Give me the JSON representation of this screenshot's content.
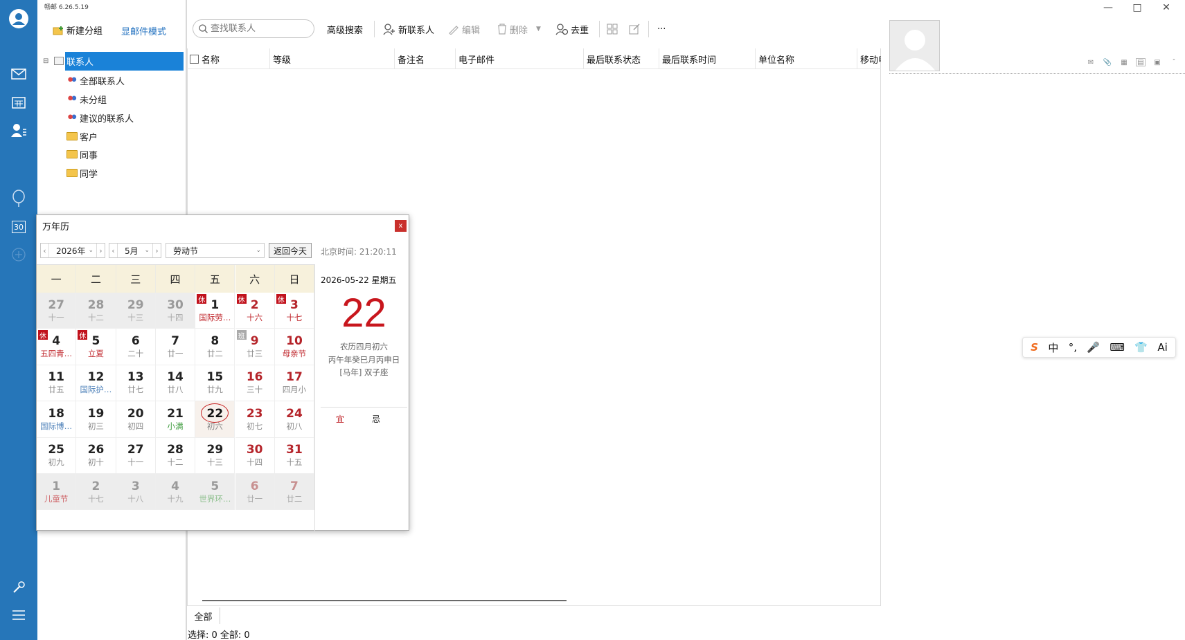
{
  "app": {
    "version": "畅邮 6.26.5.19"
  },
  "rail": {
    "icons": [
      "user-avatar-icon",
      "mail-icon",
      "calendar-icon",
      "contacts-icon",
      "balloon-icon",
      "calendar-30-icon",
      "add-icon",
      "tools-icon",
      "menu-icon"
    ],
    "accent": "#2676b9",
    "calendar_icon_text": "30"
  },
  "sidebar": {
    "new_group": "新建分组",
    "mail_mode": "显邮件模式",
    "root": "联系人",
    "items": [
      {
        "label": "全部联系人",
        "icon": "people-icon"
      },
      {
        "label": "未分组",
        "icon": "people-icon"
      },
      {
        "label": "建议的联系人",
        "icon": "people-icon"
      },
      {
        "label": "客户",
        "icon": "folder-icon"
      },
      {
        "label": "同事",
        "icon": "folder-icon"
      },
      {
        "label": "同学",
        "icon": "folder-icon"
      }
    ]
  },
  "toolbar": {
    "search_placeholder": "查找联系人",
    "advanced": "高级搜索",
    "new_contact": "新联系人",
    "edit": "编辑",
    "delete": "删除",
    "dedupe": "去重",
    "more": "···"
  },
  "table": {
    "columns": [
      "名称",
      "等级",
      "备注名",
      "电子邮件",
      "最后联系状态",
      "最后联系时间",
      "单位名称",
      "移动电话"
    ]
  },
  "bottom": {
    "tab": "全部",
    "status": "选择: 0  全部: 0"
  },
  "calendar": {
    "title": "万年历",
    "close": "x",
    "year": "2026年",
    "month": "5月",
    "holiday": "劳动节",
    "today_btn": "返回今天",
    "bj_time": "北京时间: 21:20:11",
    "weekdays": [
      "一",
      "二",
      "三",
      "四",
      "五",
      "六",
      "日"
    ],
    "cells": [
      {
        "n": "27",
        "l": "十一",
        "o": 1
      },
      {
        "n": "28",
        "l": "十二",
        "o": 1
      },
      {
        "n": "29",
        "l": "十三",
        "o": 1
      },
      {
        "n": "30",
        "l": "十四",
        "o": 1
      },
      {
        "n": "1",
        "l": "国际劳…",
        "b": "休",
        "c": "red"
      },
      {
        "n": "2",
        "l": "十六",
        "b": "休",
        "c": "red",
        "w": 1
      },
      {
        "n": "3",
        "l": "十七",
        "b": "休",
        "c": "red",
        "w": 1
      },
      {
        "n": "4",
        "l": "五四青…",
        "b": "休",
        "c": "red"
      },
      {
        "n": "5",
        "l": "立夏",
        "b": "休",
        "c": "red"
      },
      {
        "n": "6",
        "l": "二十"
      },
      {
        "n": "7",
        "l": "廿一"
      },
      {
        "n": "8",
        "l": "廿二"
      },
      {
        "n": "9",
        "l": "廿三",
        "b": "班",
        "w": 1
      },
      {
        "n": "10",
        "l": "母亲节",
        "c": "red",
        "w": 1
      },
      {
        "n": "11",
        "l": "廿五"
      },
      {
        "n": "12",
        "l": "国际护…",
        "c": "blue"
      },
      {
        "n": "13",
        "l": "廿七"
      },
      {
        "n": "14",
        "l": "廿八"
      },
      {
        "n": "15",
        "l": "廿九"
      },
      {
        "n": "16",
        "l": "三十",
        "w": 1
      },
      {
        "n": "17",
        "l": "四月小",
        "w": 1
      },
      {
        "n": "18",
        "l": "国际博…",
        "c": "blue"
      },
      {
        "n": "19",
        "l": "初三"
      },
      {
        "n": "20",
        "l": "初四"
      },
      {
        "n": "21",
        "l": "小满",
        "c": "green"
      },
      {
        "n": "22",
        "l": "初六",
        "t": 1
      },
      {
        "n": "23",
        "l": "初七",
        "w": 1
      },
      {
        "n": "24",
        "l": "初八",
        "w": 1
      },
      {
        "n": "25",
        "l": "初九"
      },
      {
        "n": "26",
        "l": "初十"
      },
      {
        "n": "27",
        "l": "十一"
      },
      {
        "n": "28",
        "l": "十二"
      },
      {
        "n": "29",
        "l": "十三"
      },
      {
        "n": "30",
        "l": "十四",
        "w": 1
      },
      {
        "n": "31",
        "l": "十五",
        "w": 1
      },
      {
        "n": "1",
        "l": "儿童节",
        "o": 1,
        "c": "red"
      },
      {
        "n": "2",
        "l": "十七",
        "o": 1
      },
      {
        "n": "3",
        "l": "十八",
        "o": 1
      },
      {
        "n": "4",
        "l": "十九",
        "o": 1
      },
      {
        "n": "5",
        "l": "世界环…",
        "o": 1,
        "c": "green"
      },
      {
        "n": "6",
        "l": "廿一",
        "o": 1,
        "w": 1
      },
      {
        "n": "7",
        "l": "廿二",
        "o": 1,
        "w": 1
      }
    ],
    "detail": {
      "date": "2026-05-22  星期五",
      "day": "22",
      "lunar": "农历四月初六",
      "ganzhi": "丙午年癸巳月丙申日",
      "zodiac": "[马年] 双子座",
      "yi": "宜",
      "ji": "忌"
    }
  },
  "ime": {
    "items": [
      "S",
      "中",
      "°,",
      "mic-icon",
      "keyboard-icon",
      "shirt-icon",
      "Ai"
    ]
  }
}
